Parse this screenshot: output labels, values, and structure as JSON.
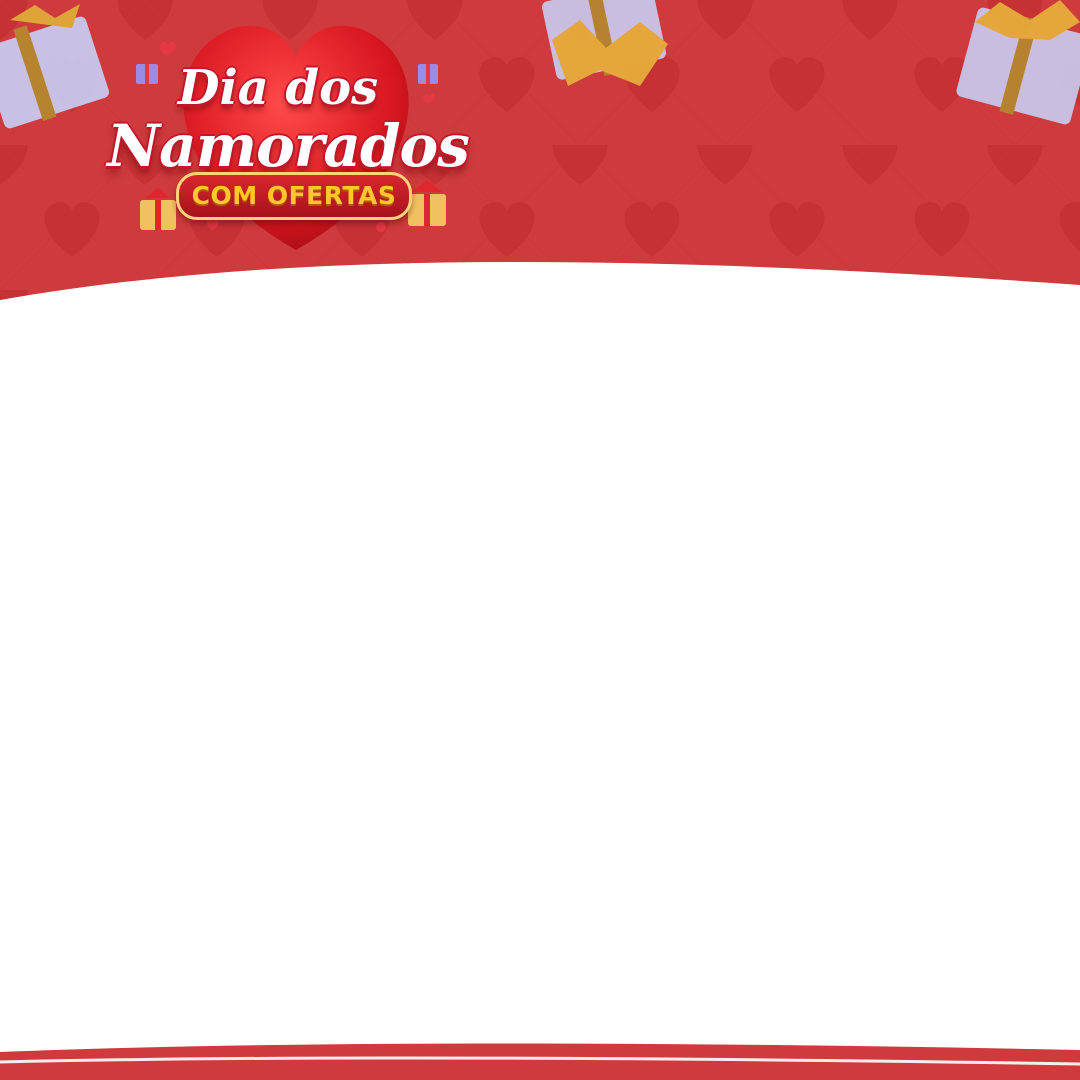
{
  "banner": {
    "title_line1": "Dia dos",
    "title_line2": "Namorados",
    "badge": "COM OFERTAS"
  },
  "colors": {
    "background_red": "#cf3a3c",
    "heart_pattern": "#c42f33",
    "heart_logo": "#e0222b",
    "badge_text": "#ffc72c",
    "gift_box": "#c9cdf2",
    "ribbon_gold": "#d6a12a",
    "content_area": "#ffffff"
  },
  "icons": [
    "heart-icon",
    "gift-box-icon"
  ]
}
